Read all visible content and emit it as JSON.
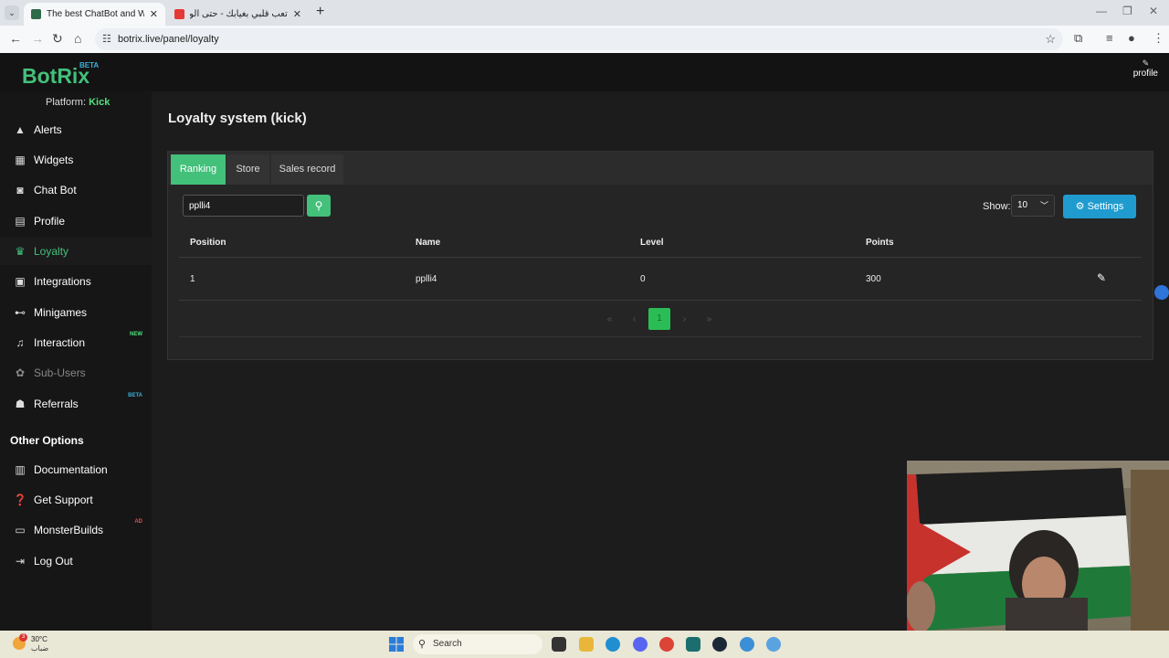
{
  "browser": {
    "tabs": [
      {
        "title": "The best ChatBot and Widgets",
        "active": true
      },
      {
        "title": "تعب قلبي بغيابك - حتى الورد كذا",
        "active": false
      }
    ],
    "url": "botrix.live/panel/loyalty"
  },
  "header": {
    "logo": "BotRix",
    "logo_badge": "BETA",
    "profile_label": "profile"
  },
  "sidebar": {
    "platform_label": "Platform:",
    "platform_value": "Kick",
    "items": [
      {
        "label": "Alerts",
        "icon": "warning-icon"
      },
      {
        "label": "Widgets",
        "icon": "grid-icon"
      },
      {
        "label": "Chat Bot",
        "icon": "robot-icon"
      },
      {
        "label": "Profile",
        "icon": "id-card-icon"
      },
      {
        "label": "Loyalty",
        "icon": "trophy-icon",
        "active": true
      },
      {
        "label": "Integrations",
        "icon": "list-icon"
      },
      {
        "label": "Minigames",
        "icon": "gamepad-icon"
      },
      {
        "label": "Interaction",
        "icon": "music-icon",
        "badge": "NEW"
      },
      {
        "label": "Sub-Users",
        "icon": "users-icon",
        "dim": true
      },
      {
        "label": "Referrals",
        "icon": "referral-icon",
        "badge": "BETA"
      }
    ],
    "other_section_title": "Other Options",
    "other_items": [
      {
        "label": "Documentation",
        "icon": "book-icon"
      },
      {
        "label": "Get Support",
        "icon": "question-icon"
      },
      {
        "label": "MonsterBuilds",
        "icon": "laptop-icon",
        "badge": "AD"
      },
      {
        "label": "Log Out",
        "icon": "logout-icon"
      }
    ],
    "badge_colors": {
      "NEW": "#53e07f",
      "BETA": "#3ab0d9",
      "AD": "#d9534f"
    }
  },
  "main": {
    "title": "Loyalty system (kick)",
    "tabs": [
      "Ranking",
      "Store",
      "Sales record"
    ],
    "search_value": "pplli4",
    "show_label": "Show:",
    "show_value": "10",
    "settings_label": "Settings",
    "columns": [
      "Position",
      "Name",
      "Level",
      "Points"
    ],
    "rows": [
      {
        "position": "1",
        "name": "pplli4",
        "level": "0",
        "points": "300"
      }
    ],
    "pagination": {
      "current_page": "1"
    }
  },
  "taskbar": {
    "weather_temp": "30°C",
    "weather_desc": "ضباب",
    "weather_badge": "3",
    "search_placeholder": "Search"
  },
  "colors": {
    "accent_green": "#43c07a",
    "settings_blue": "#1f9bcf",
    "background": "#1c1c1c"
  }
}
